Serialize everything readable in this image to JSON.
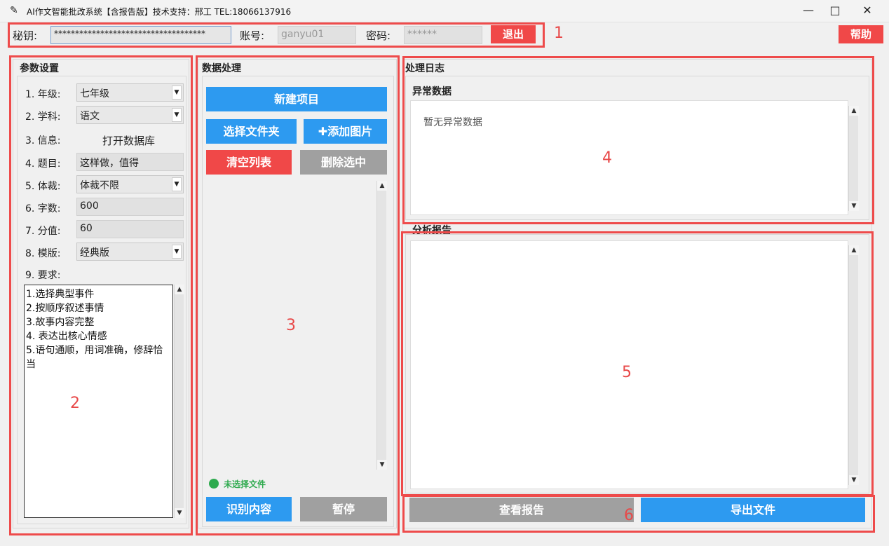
{
  "window": {
    "title": "AI作文智能批改系统【含报告版】技术支持：邢工 TEL:18066137916"
  },
  "topbar": {
    "key_label": "秘钥:",
    "key_value": "************************************",
    "account_label": "账号:",
    "account_value": "ganyu01",
    "password_label": "密码:",
    "password_value": "******",
    "logout_label": "退出",
    "help_label": "帮助"
  },
  "params": {
    "title": "参数设置",
    "grade_label": "1. 年级:",
    "grade_value": "七年级",
    "subject_label": "2. 学科:",
    "subject_value": "语文",
    "info_label": "3. 信息:",
    "info_link": "打开数据库",
    "topic_label": "4. 题目:",
    "topic_value": "这样做，值得",
    "genre_label": "5. 体裁:",
    "genre_value": "体裁不限",
    "words_label": "6. 字数:",
    "words_value": "600",
    "score_label": "7. 分值:",
    "score_value": "60",
    "template_label": "8. 模版:",
    "template_value": "经典版",
    "requirements_label": "9. 要求:",
    "requirements": [
      "1.选择典型事件",
      "2.按顺序叙述事情",
      "3.故事内容完整",
      "4. 表达出核心情感",
      "5.语句通顺，用词准确，修辞恰",
      "当"
    ]
  },
  "data": {
    "title": "数据处理",
    "new_project": "新建项目",
    "select_folder": "选择文件夹",
    "add_image": "添加图片",
    "clear_list": "清空列表",
    "delete_selected": "删除选中",
    "status": "未选择文件",
    "recognize": "识别内容",
    "pause": "暂停"
  },
  "log": {
    "title": "处理日志",
    "abnormal_title": "异常数据",
    "abnormal_text": "暂无异常数据",
    "report_title": "分析报告",
    "view_report": "查看报告",
    "export_file": "导出文件"
  },
  "annotations": [
    "1",
    "2",
    "3",
    "4",
    "5",
    "6"
  ],
  "colors": {
    "blue": "#2d9af0",
    "red": "#f04848",
    "gray": "#a0a0a0",
    "annotation": "#ee4b4b",
    "status_green": "#2eaa4e"
  }
}
